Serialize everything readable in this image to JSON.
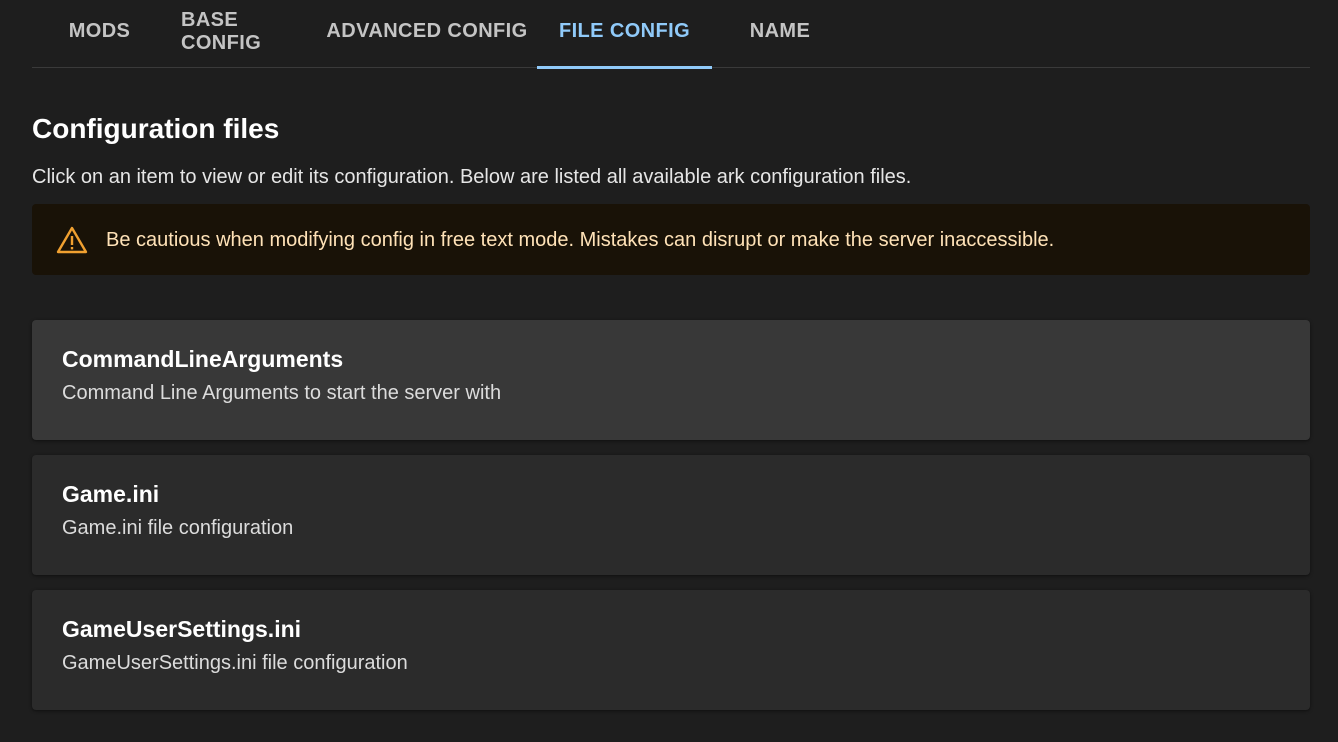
{
  "tabs": [
    {
      "label": "MODS"
    },
    {
      "label": "BASE CONFIG"
    },
    {
      "label": "ADVANCED CONFIG"
    },
    {
      "label": "FILE CONFIG",
      "active": true
    },
    {
      "label": "NAME"
    }
  ],
  "section": {
    "title": "Configuration files",
    "description": "Click on an item to view or edit its configuration. Below are listed all available ark configuration files."
  },
  "alert": {
    "icon": "warning-triangle-icon",
    "text": "Be cautious when modifying config in free text mode. Mistakes can disrupt or make the server inaccessible.",
    "color": "#f0a030"
  },
  "files": [
    {
      "title": "CommandLineArguments",
      "description": "Command Line Arguments to start the server with"
    },
    {
      "title": "Game.ini",
      "description": "Game.ini file configuration"
    },
    {
      "title": "GameUserSettings.ini",
      "description": "GameUserSettings.ini file configuration"
    }
  ],
  "colors": {
    "accent": "#90caf9",
    "background": "#1e1e1e",
    "alert_background": "#191207",
    "alert_text": "#ffe2b7"
  }
}
